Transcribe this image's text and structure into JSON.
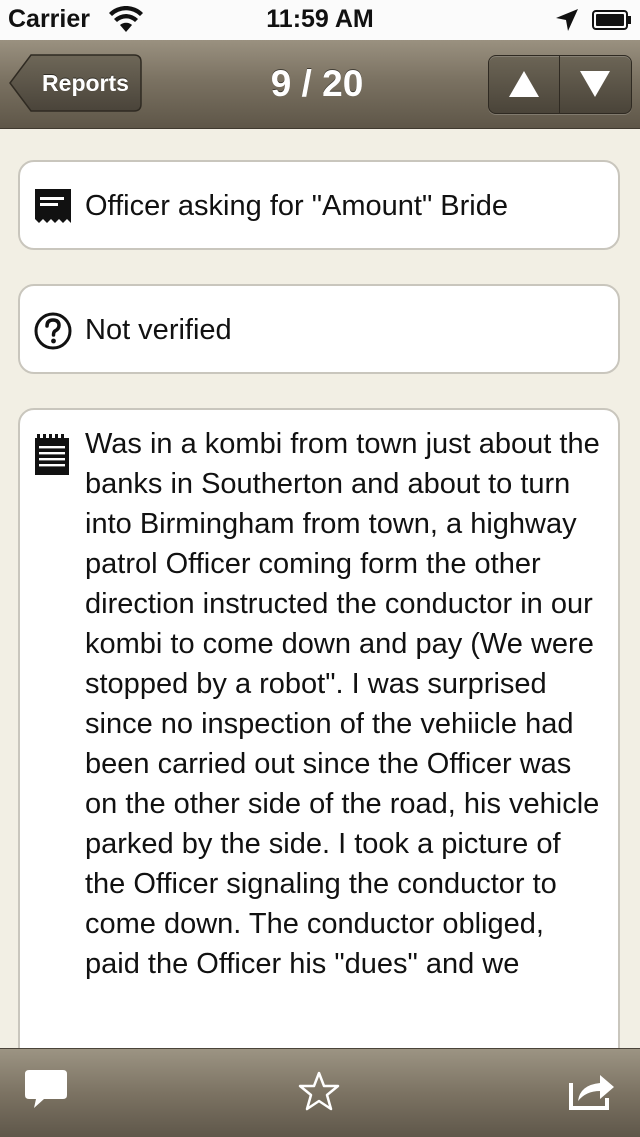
{
  "status_bar": {
    "carrier": "Carrier",
    "time": "11:59 AM"
  },
  "nav": {
    "back_label": "Reports",
    "title": "9 / 20",
    "prev_icon": "triangle-up-icon",
    "next_icon": "triangle-down-icon"
  },
  "report": {
    "title": "Officer asking for \"Amount\" Bride",
    "verification_status": "Not verified",
    "description": "Was in a kombi from town just about the banks in Southerton and about to turn into Birmingham from town, a highway patrol Officer coming form the other direction instructed the conductor in our kombi to come down and pay (We were stopped by a robot\". I was surprised since no inspection of the vehiicle had been carried out since the Officer was on the other side of the road, his vehicle parked by the side. I took a picture of the Officer signaling the conductor to come down. The conductor obliged, paid the Officer his \"dues\" and we"
  },
  "toolbar": {
    "items": [
      "comment-icon",
      "star-icon",
      "share-icon"
    ]
  },
  "colors": {
    "background": "#f2efe4",
    "navbar": "#7b7262",
    "card_border": "#c9c6bd"
  }
}
